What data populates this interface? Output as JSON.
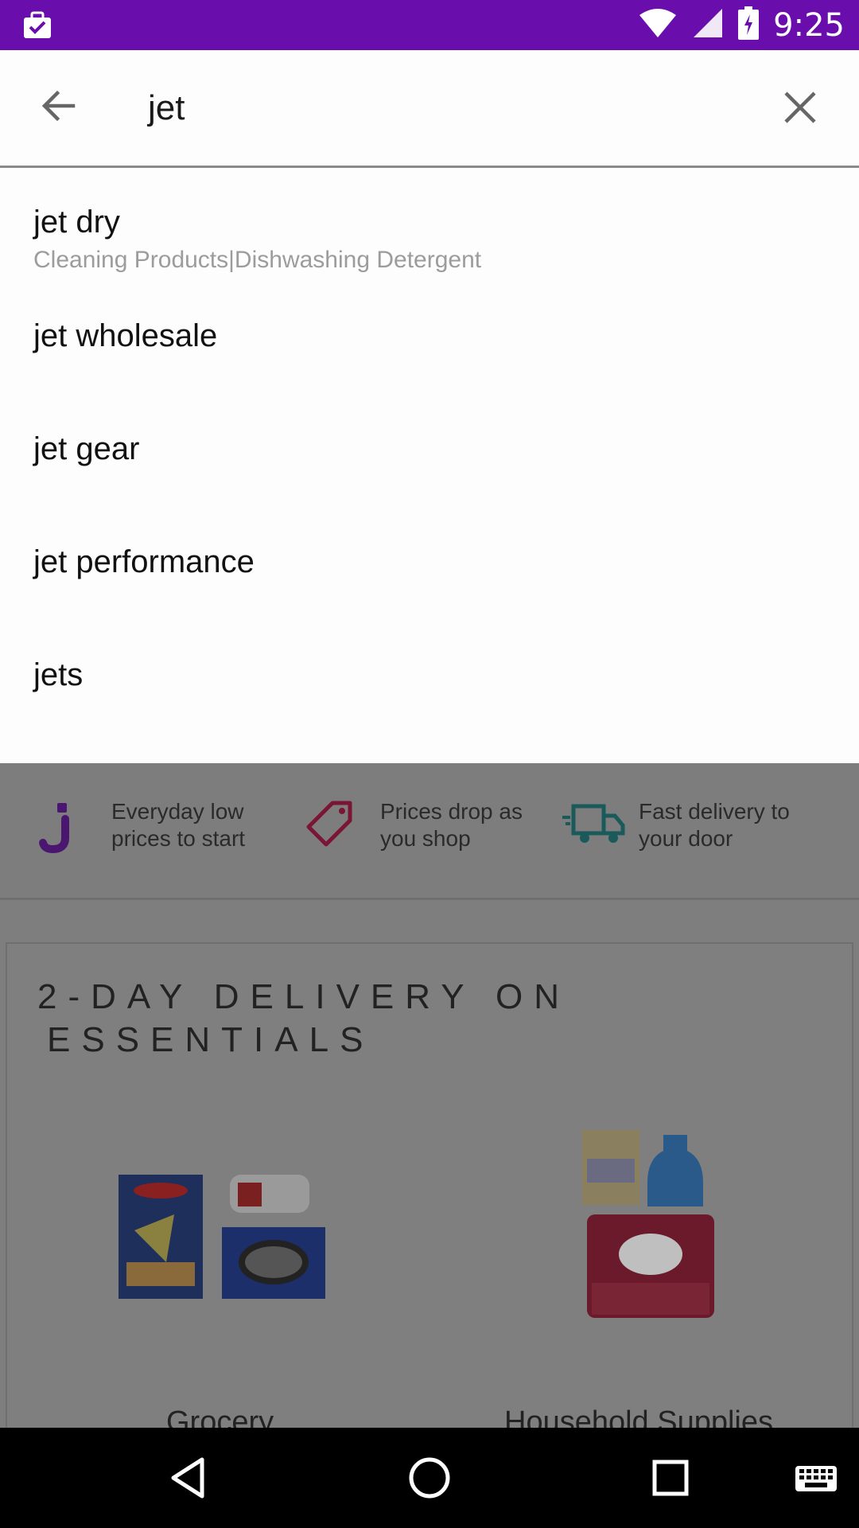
{
  "status_bar": {
    "time": "9:25",
    "icons": [
      "briefcase-check-icon",
      "wifi-icon",
      "signal-icon",
      "battery-charging-icon"
    ],
    "background": "#6a0dad"
  },
  "search": {
    "query": "jet",
    "back_icon": "arrow-left-icon",
    "clear_icon": "close-icon"
  },
  "suggestions": [
    {
      "label": "jet dry",
      "sub": "Cleaning Products|Dishwashing Detergent"
    },
    {
      "label": "jet wholesale",
      "sub": ""
    },
    {
      "label": "jet gear",
      "sub": ""
    },
    {
      "label": "jet performance",
      "sub": ""
    },
    {
      "label": "jets",
      "sub": ""
    }
  ],
  "value_props": [
    {
      "icon": "jet-logo-icon",
      "text": "Everyday low prices to start",
      "color": "#5a1b8a"
    },
    {
      "icon": "price-tag-icon",
      "text": "Prices drop as you shop",
      "color": "#8a1b3a"
    },
    {
      "icon": "delivery-truck-icon",
      "text": "Fast delivery to your door",
      "color": "#1b6a6a"
    }
  ],
  "promo_card": {
    "title_line1": "2-DAY DELIVERY ON",
    "title_line2": "ESSENTIALS",
    "categories": [
      {
        "label": "Grocery",
        "icon": "grocery-products-image"
      },
      {
        "label": "Household Supplies",
        "icon": "household-supplies-image"
      }
    ]
  },
  "nav_bar": {
    "buttons": [
      "back-triangle-icon",
      "home-circle-icon",
      "recents-square-icon",
      "keyboard-icon"
    ]
  }
}
